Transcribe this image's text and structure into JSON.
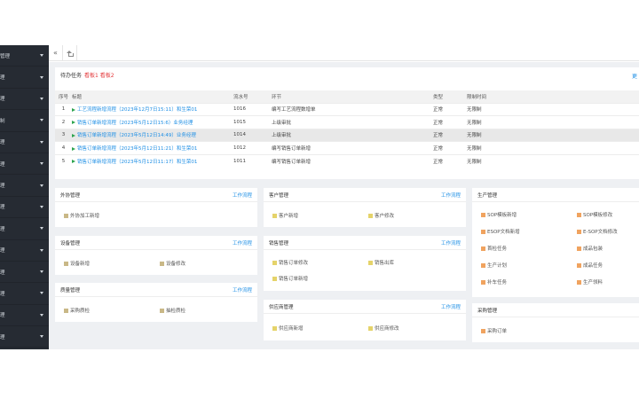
{
  "sidebar": {
    "items": [
      {
        "label": "管理"
      },
      {
        "label": "理"
      },
      {
        "label": "理"
      },
      {
        "label": "制"
      },
      {
        "label": "理"
      },
      {
        "label": "理"
      },
      {
        "label": "理"
      },
      {
        "label": "理"
      },
      {
        "label": "理"
      },
      {
        "label": "理"
      },
      {
        "label": "理"
      },
      {
        "label": "理"
      },
      {
        "label": "理"
      },
      {
        "label": "理"
      }
    ]
  },
  "tabbar": {
    "back_glyph": "«",
    "home_icon": "home-icon"
  },
  "todo": {
    "title": "待办任务",
    "alert": "看板1 看板2",
    "right_link": "更",
    "columns": {
      "idx": "序号",
      "title": "标题",
      "no": "流水号",
      "node": "环节",
      "type": "类型",
      "limit": "限制时间"
    },
    "rows": [
      {
        "idx": "1",
        "title": "工艺流程新增流程（2023年12月7日15:11）和生荣01",
        "no": "1016",
        "node": "编写工艺流程数增单",
        "type": "正常",
        "limit": "无限制"
      },
      {
        "idx": "2",
        "title": "销售订单新增流程（2023年5月12日15:6）业务经理",
        "no": "1015",
        "node": "上级审批",
        "type": "正常",
        "limit": "无限制"
      },
      {
        "idx": "3",
        "title": "销售订单新增流程（2023年5月12日14:49）业务经理",
        "no": "1014",
        "node": "上级审批",
        "type": "正常",
        "limit": "无限制"
      },
      {
        "idx": "4",
        "title": "销售订单新增流程（2023年5月12日11:21）和生荣01",
        "no": "1012",
        "node": "编写销售订单新增",
        "type": "正常",
        "limit": "无限制"
      },
      {
        "idx": "5",
        "title": "销售订单新增流程（2023年5月12日11:17）和生荣01",
        "no": "1011",
        "node": "编写销售订单新增",
        "type": "正常",
        "limit": "无限制"
      }
    ]
  },
  "panels": {
    "waixie": {
      "title": "外协管理",
      "link": "工作流程",
      "items": [
        "外协加工新增"
      ]
    },
    "shebei": {
      "title": "设备管理",
      "link": "工作流程",
      "items": [
        "设备新增",
        "设备修改"
      ]
    },
    "zhiliang": {
      "title": "质量管理",
      "link": "工作流程",
      "items": [
        "采购质检",
        "抽检质检"
      ]
    },
    "kehu": {
      "title": "客户管理",
      "link": "工作流程",
      "items": [
        "客户新增",
        "客户修改"
      ]
    },
    "xiaoshou": {
      "title": "销售管理",
      "link": "工作流程",
      "items": [
        "销售订单修改",
        "销售出库",
        "销售订单新增"
      ]
    },
    "gongying": {
      "title": "供应商管理",
      "link": "工作流程",
      "items": [
        "供应商新增",
        "供应商修改"
      ]
    },
    "shengchan": {
      "title": "生产管理",
      "items": [
        "SOP模板新增",
        "SOP模板修改",
        "ESOP文档新增",
        "E-SOP文档修改",
        "首检任务",
        "成品包装",
        "生产计划",
        "成品任务",
        "补车任务",
        "生产领料"
      ]
    },
    "caigou": {
      "title": "采购管理",
      "items": [
        "采购订单"
      ]
    }
  },
  "colors": {
    "sidebar_bg": "#262b33",
    "link": "#1f8fe5",
    "alert": "#e4393c",
    "flag": "#2da44e"
  }
}
